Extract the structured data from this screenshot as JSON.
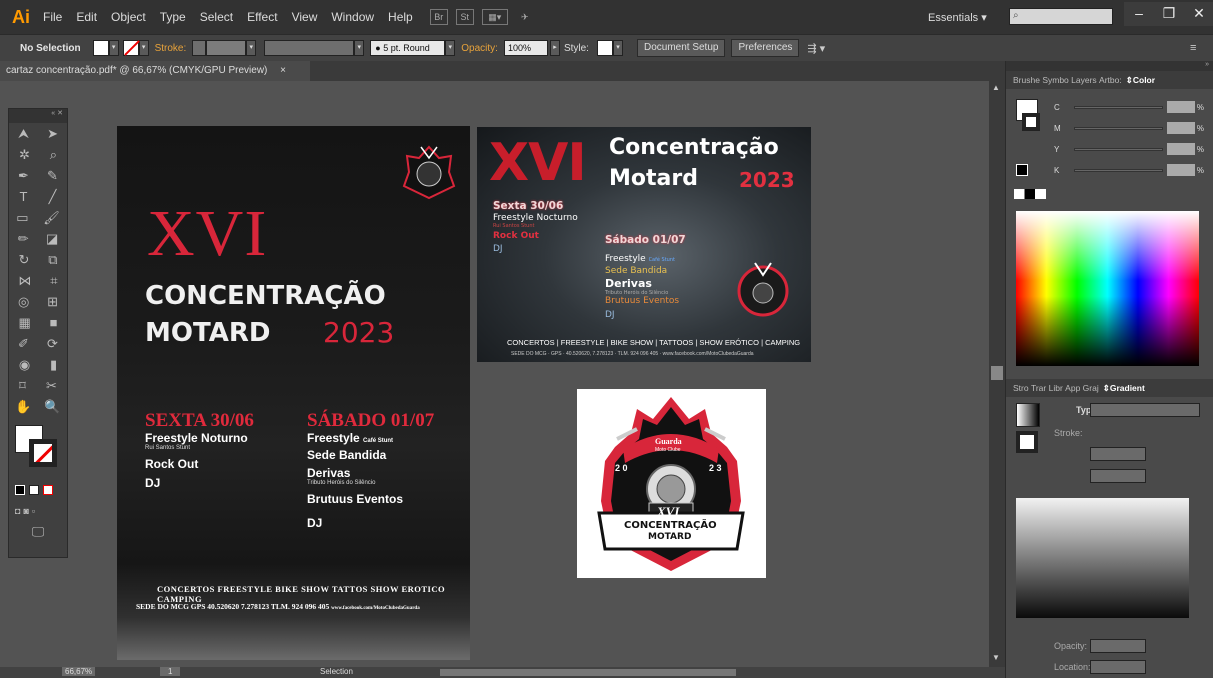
{
  "app": {
    "logo": "Ai"
  },
  "menu": [
    "File",
    "Edit",
    "Object",
    "Type",
    "Select",
    "Effect",
    "View",
    "Window",
    "Help"
  ],
  "menubar_icons": {
    "br": "Br",
    "st": "St"
  },
  "workspace": "Essentials",
  "control": {
    "selection": "No Selection",
    "stroke": "Stroke:",
    "brush": "5 pt. Round",
    "opacity_label": "Opacity:",
    "opacity": "100%",
    "style_label": "Style:",
    "doc_setup": "Document Setup",
    "preferences": "Preferences"
  },
  "tab": {
    "title": "cartaz concentração.pdf* @ 66,67% (CMYK/GPU Preview)",
    "close": "×"
  },
  "poster1": {
    "numeral": "XVI",
    "title1": "CONCENTRAÇÃO",
    "title2": "MOTARD",
    "year": "2023",
    "day1": "SEXTA 30/06",
    "day1_events": [
      "Freestyle Noturno",
      "Rock Out",
      "DJ"
    ],
    "day1_sub": "Rui Santos Stunt",
    "day2": "SÁBADO 01/07",
    "day2_events": [
      "Freestyle",
      "Sede Bandida",
      "Derivas",
      "Brutuus Eventos",
      "DJ"
    ],
    "day2_sub1": "Café Stunt",
    "day2_sub2": "Tributo Heróis do Silêncio",
    "footer1": "CONCERTOS   FREESTYLE   BIKE SHOW   TATTOS   SHOW EROTICO   CAMPING",
    "footer2": "SEDE DO MCG  GPS  40.520620  7.278123  TLM. 924 096 405",
    "footer2_url": "www.facebook.com/MotoClubedaGuarda"
  },
  "poster2": {
    "numeral": "XVI",
    "title1": "Concentração",
    "title2": "Motard",
    "year": "2023",
    "day1": "Sexta 30/06",
    "day1_events": [
      "Freestyle Nocturno",
      "Rock Out",
      "DJ"
    ],
    "day1_sub": "Rui Santos Stunt",
    "day2": "Sábado 01/07",
    "day2_events": [
      "Freestyle",
      "Sede Bandida",
      "Derivas",
      "Brutuus Eventos",
      "DJ"
    ],
    "day2_sub1": "Café Stunt",
    "day2_sub2": "Tributo Heróis do Silêncio",
    "footer1": "CONCERTOS | FREESTYLE | BIKE SHOW | TATTOOS | SHOW ERÓTICO | CAMPING",
    "footer2": "SEDE DO MCG · GPS · 40.520620, 7.278123 · TLM. 924 096 405 · www.facebook.com/MotoClubedaGuarda"
  },
  "logo": {
    "guarda": "Guarda",
    "moto": "Moto Clube",
    "year_left": "2 0",
    "year_right": "2 3",
    "numeral": "XVI",
    "line1": "CONCENTRAÇÃO",
    "line2": "MOTARD"
  },
  "color_panel": {
    "tabs": [
      "Brushe",
      "Symbo",
      "Layers",
      "Artbo:"
    ],
    "active": "Color",
    "channels": [
      "C",
      "M",
      "Y",
      "K"
    ],
    "pct": "%"
  },
  "gradient_panel": {
    "tabs": [
      "Stro",
      "Trar",
      "Libr",
      "App",
      "Graj"
    ],
    "active": "Gradient",
    "type_label": "Type:",
    "stroke_label": "Stroke:",
    "opacity_label": "Opacity:",
    "location_label": "Location:"
  },
  "status": {
    "zoom": "66,67%",
    "page": "1",
    "tool": "Selection"
  },
  "colors": {
    "accent_red": "#d8263a",
    "ai_orange": "#ff9a00",
    "ui_dark": "#323232"
  }
}
